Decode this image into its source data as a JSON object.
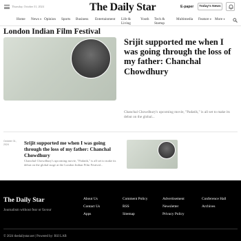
{
  "header": {
    "date": "Thursday, October 31, 2024",
    "logo": "The Daily Star",
    "epaper": "E-paper",
    "todays_news": "Today's News"
  },
  "nav": {
    "items": [
      "Home",
      "News",
      "Opinion",
      "Sports",
      "Business",
      "Entertainment",
      "Life & Living",
      "Youth",
      "Tech & Startup",
      "Multimedia",
      "Feature",
      "More"
    ]
  },
  "section": {
    "title": "London Indian Film Festival"
  },
  "lead": {
    "title": "Srijit supported me when I was going through the loss of my father: Chanchal Chowdhury",
    "excerpt": "Chanchal Chowdhury's upcoming movie, \"Padatik,\" is all set to make its debut on the global..."
  },
  "list": [
    {
      "date": "October 31, 2024",
      "title": "Srijit supported me when I was going through the loss of my father: Chanchal Chowdhury",
      "excerpt": "Chanchal Chowdhury's upcoming movie, \"Padatik,\" is all set to make its debut on the global stage at the London Indian Film Festival..."
    }
  ],
  "footer": {
    "logo": "The Daily Star",
    "tagline": "Journalism without fear or favour",
    "links": [
      [
        "About Us",
        "Contact Us",
        "Apps"
      ],
      [
        "Comment Policy",
        "RSS",
        "Sitemap"
      ],
      [
        "Advertisement",
        "Newsletter",
        "Privacy Policy"
      ],
      [
        "Conference Hall",
        "Archives"
      ]
    ],
    "copyright": "© 2024 thedailystar.net | Powered by: RSI LAB"
  },
  "colors": {
    "footer_bg": "#000000",
    "text": "#111111",
    "muted": "#777777"
  },
  "icons": [
    "menu-icon",
    "notification-bell-icon",
    "search-icon",
    "caret-down-icon"
  ]
}
